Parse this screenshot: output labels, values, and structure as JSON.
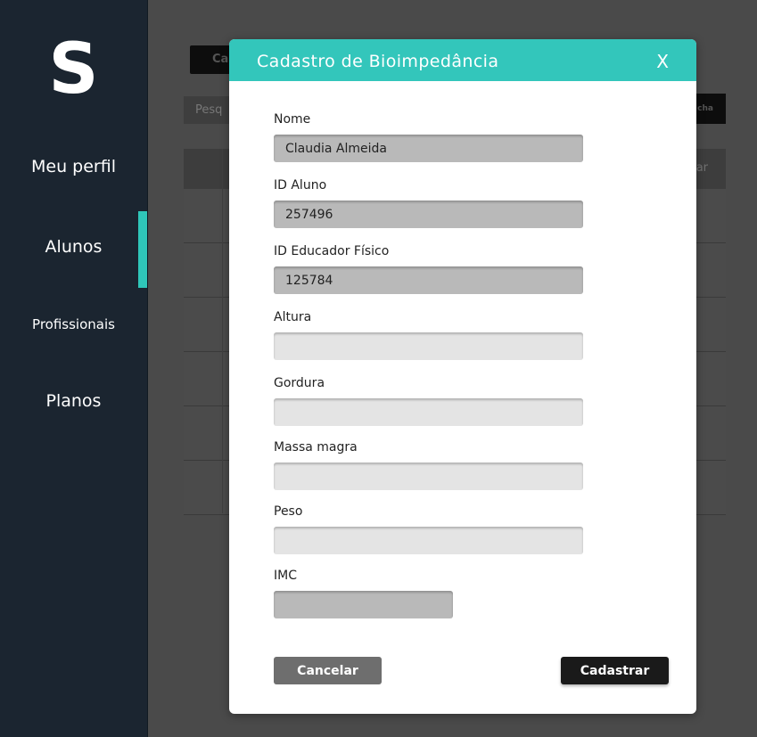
{
  "sidebar": {
    "logo": "S",
    "items": [
      {
        "label": "Meu perfil"
      },
      {
        "label": "Alunos"
      },
      {
        "label": "Profissionais"
      },
      {
        "label": "Planos"
      }
    ],
    "active_item": "Alunos"
  },
  "background": {
    "add_button_label": "Ca",
    "search_placeholder": "Pesq",
    "search_button_label": "cha",
    "table_header_partial": "ar"
  },
  "modal": {
    "title": "Cadastro de Bioimpedância",
    "close_label": "X",
    "fields": {
      "nome": {
        "label": "Nome",
        "value": "Claudia Almeida"
      },
      "id_aluno": {
        "label": "ID Aluno",
        "value": "257496"
      },
      "id_educador": {
        "label": "ID Educador Físico",
        "value": "125784"
      },
      "altura": {
        "label": "Altura",
        "value": ""
      },
      "gordura": {
        "label": "Gordura",
        "value": ""
      },
      "massa_magra": {
        "label": "Massa magra",
        "value": ""
      },
      "peso": {
        "label": "Peso",
        "value": ""
      },
      "imc": {
        "label": "IMC",
        "value": ""
      }
    },
    "cancel_label": "Cancelar",
    "submit_label": "Cadastrar"
  },
  "colors": {
    "accent": "#33c6bb",
    "sidebar_bg": "#1b2530",
    "overlay_bg": "#4a4a4a"
  }
}
